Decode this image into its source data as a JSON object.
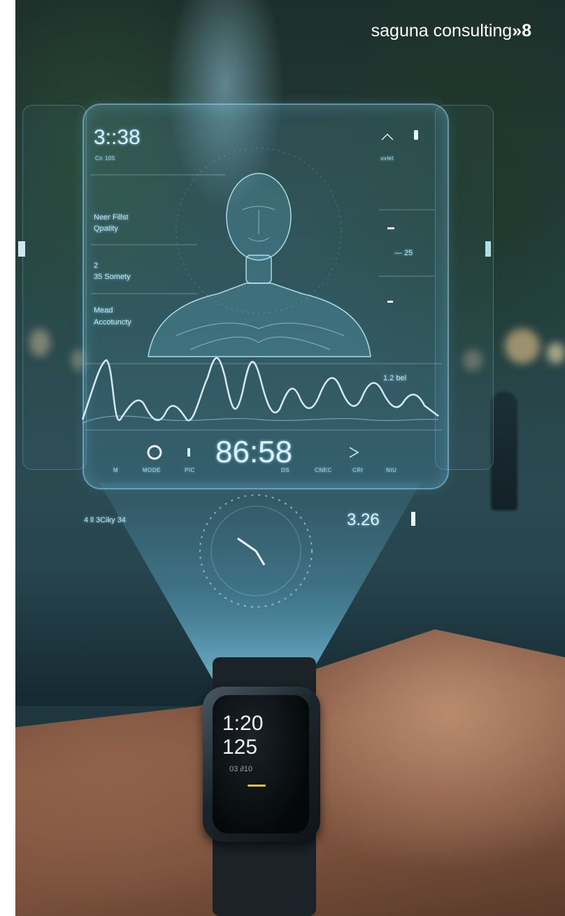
{
  "brand": {
    "logo_text": "saguna consulting",
    "logo_mark": "»8"
  },
  "hologram": {
    "time": "3::38",
    "time_sub": "Cn 105",
    "status_right": "uvlet",
    "metrics_left": [
      {
        "value": "Neer Fillst",
        "label": "Qpatity"
      },
      {
        "value": "2",
        "label": "35 Somety"
      },
      {
        "value": "Mead",
        "label": "Accotuncty"
      }
    ],
    "right_readout": "1.2 bel",
    "right_small": "— 25",
    "main_readout": "86:58",
    "bottom_labels": [
      "M",
      "MODE",
      "PIC",
      "DS",
      "CNEC",
      "CRI",
      "NIU"
    ],
    "lower_left": "4 ll 3Ciky 34",
    "lower_right": "3.26"
  },
  "watch": {
    "line1": "1:20",
    "line2": "125",
    "line3": "03 ∂10"
  }
}
